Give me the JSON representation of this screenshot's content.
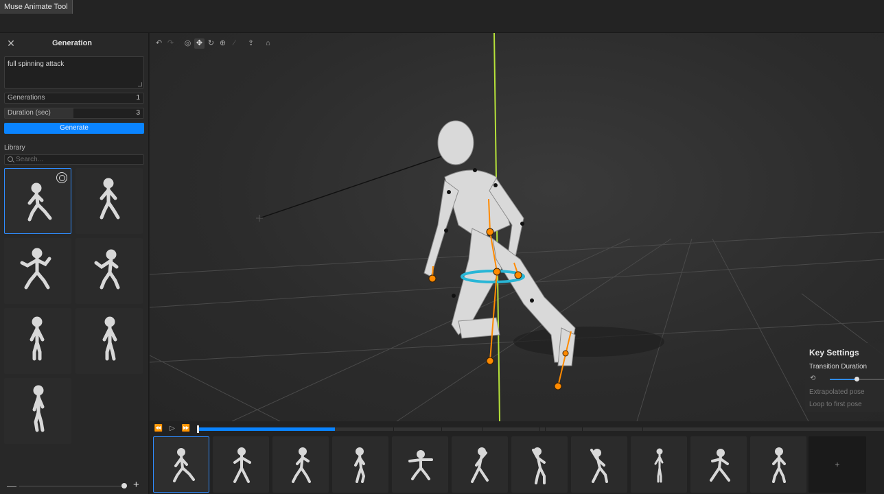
{
  "app": {
    "title": "Muse Animate Tool"
  },
  "generation": {
    "title": "Generation",
    "prompt": "full spinning attack",
    "generations_label": "Generations",
    "generations_value": "1",
    "duration_label": "Duration (sec)",
    "duration_value": "3",
    "generate_button": "Generate"
  },
  "library": {
    "label": "Library",
    "search_placeholder": "Search..."
  },
  "key_settings": {
    "title": "Key Settings",
    "transition_label": "Transition Duration",
    "transition_level": 0.5,
    "extrapolated_label": "Extrapolated pose",
    "loop_label": "Loop to first pose"
  },
  "timeline": {
    "progress": 0.2,
    "add_label": "+"
  },
  "colors": {
    "accent": "#0a84ff",
    "bone_orange": "#ff8a00",
    "axis_green": "#b6e23a",
    "ring_cyan": "#29b6d6"
  }
}
